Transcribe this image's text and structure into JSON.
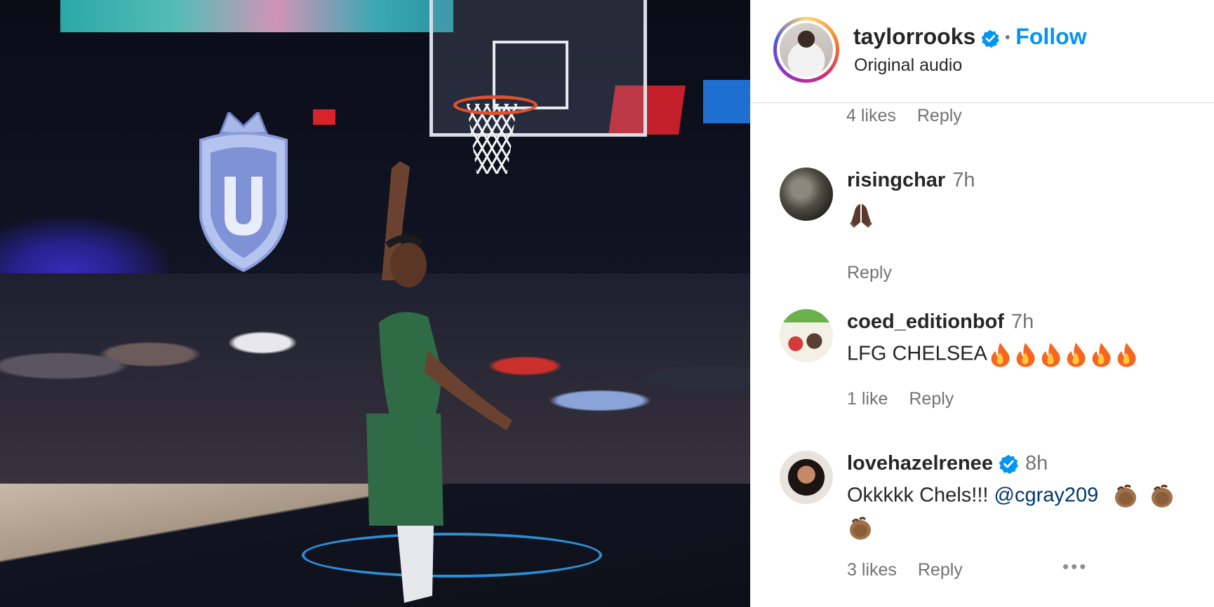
{
  "post": {
    "username": "taylorrooks",
    "follow_label": "Follow",
    "audio": "Original audio",
    "colors": {
      "accent": "#0095f6",
      "verified": "#0095f6",
      "muted": "#737373"
    }
  },
  "first_meta": {
    "likes": "4 likes",
    "reply": "Reply"
  },
  "comments": [
    {
      "username": "risingchar",
      "time": "7h",
      "text": "",
      "emoji": [
        "praying-hands-icon"
      ],
      "reply": "Reply"
    },
    {
      "username": "coed_editionbof",
      "time": "7h",
      "text": "LFG CHELSEA",
      "emoji": [
        "fire-icon",
        "fire-icon",
        "fire-icon",
        "fire-icon",
        "fire-icon",
        "fire-icon"
      ],
      "likes": "1 like",
      "reply": "Reply"
    },
    {
      "username": "lovehazelrenee",
      "verified": true,
      "time": "8h",
      "text": "Okkkkk Chels!!! ",
      "mention": "@cgray209",
      "emoji": [
        "clapping-hands-icon",
        "clapping-hands-icon",
        "clapping-hands-icon"
      ],
      "likes": "3 likes",
      "reply": "Reply",
      "more": "•••"
    }
  ]
}
